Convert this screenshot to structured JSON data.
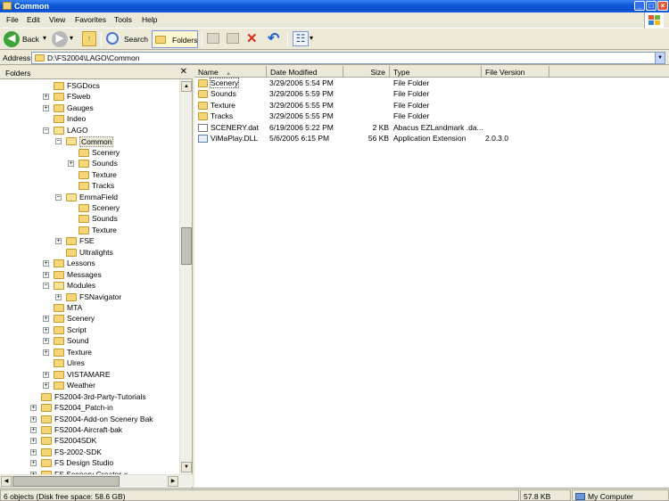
{
  "window": {
    "title": "Common",
    "min_label": "_",
    "max_label": "□",
    "close_label": "×",
    "brand_colors": {
      "titlebar": "#0b4fcf",
      "close": "#e0583a"
    }
  },
  "menu": {
    "file": "File",
    "edit": "Edit",
    "view": "View",
    "favorites": "Favorites",
    "tools": "Tools",
    "help": "Help"
  },
  "toolbar": {
    "back": "Back",
    "search": "Search",
    "folders": "Folders",
    "back_glyph": "◀",
    "forward_glyph": "▶",
    "dropdown_glyph": "▾",
    "up_glyph": "↑",
    "delete_glyph": "✕",
    "undo_glyph": "↶",
    "views_glyph": "☷"
  },
  "address": {
    "label": "Address",
    "path": "D:\\FS2004\\LAGO\\Common",
    "dropdown_glyph": "▼"
  },
  "folders_pane": {
    "header": "Folders",
    "close_glyph": "✕",
    "nodes": [
      {
        "label": "FSGDocs",
        "expander": ""
      },
      {
        "label": "FSweb",
        "expander": "+"
      },
      {
        "label": "Gauges",
        "expander": "+"
      },
      {
        "label": "Indeo",
        "expander": ""
      },
      {
        "label": "LAGO",
        "expander": "−"
      },
      {
        "label": "Common",
        "expander": "−"
      },
      {
        "label": "Scenery",
        "expander": ""
      },
      {
        "label": "Sounds",
        "expander": "+"
      },
      {
        "label": "Texture",
        "expander": ""
      },
      {
        "label": "Tracks",
        "expander": ""
      },
      {
        "label": "EmmaField",
        "expander": "−"
      },
      {
        "label": "Scenery",
        "expander": ""
      },
      {
        "label": "Sounds",
        "expander": ""
      },
      {
        "label": "Texture",
        "expander": ""
      },
      {
        "label": "FSE",
        "expander": "+"
      },
      {
        "label": "Ultralights",
        "expander": ""
      },
      {
        "label": "Lessons",
        "expander": "+"
      },
      {
        "label": "Messages",
        "expander": "+"
      },
      {
        "label": "Modules",
        "expander": "−"
      },
      {
        "label": "FSNavigator",
        "expander": "+"
      },
      {
        "label": "MTA",
        "expander": ""
      },
      {
        "label": "Scenery",
        "expander": "+"
      },
      {
        "label": "Script",
        "expander": "+"
      },
      {
        "label": "Sound",
        "expander": "+"
      },
      {
        "label": "Texture",
        "expander": "+"
      },
      {
        "label": "Uires",
        "expander": ""
      },
      {
        "label": "VISTAMARE",
        "expander": "+"
      },
      {
        "label": "Weather",
        "expander": "+"
      },
      {
        "label": "FS2004-3rd-Party-Tutorials",
        "expander": ""
      },
      {
        "label": "FS2004_Patch-in",
        "expander": "+"
      },
      {
        "label": "FS2004-Add-on Scenery Bak",
        "expander": "+"
      },
      {
        "label": "FS2004-Aircraft-bak",
        "expander": "+"
      },
      {
        "label": "FS2004SDK",
        "expander": "+"
      },
      {
        "label": "FS-2002-SDK",
        "expander": "+"
      },
      {
        "label": "FS Design Studio",
        "expander": "+"
      },
      {
        "label": "FS Scenery Creator-x",
        "expander": "+"
      }
    ],
    "scroll_up": "▲",
    "scroll_down": "▼",
    "scroll_left": "◀",
    "scroll_right": "▶"
  },
  "file_list": {
    "columns": {
      "name": "Name",
      "sort_glyph": "▲",
      "date": "Date Modified",
      "size": "Size",
      "type": "Type",
      "version": "File Version"
    },
    "rows": [
      {
        "icon": "folder-icon",
        "name": "Scenery",
        "date": "3/29/2006 5:54 PM",
        "size": "",
        "type": "File Folder",
        "version": ""
      },
      {
        "icon": "folder-icon",
        "name": "Sounds",
        "date": "3/29/2006 5:59 PM",
        "size": "",
        "type": "File Folder",
        "version": ""
      },
      {
        "icon": "folder-icon",
        "name": "Texture",
        "date": "3/29/2006 5:55 PM",
        "size": "",
        "type": "File Folder",
        "version": ""
      },
      {
        "icon": "folder-icon",
        "name": "Tracks",
        "date": "3/29/2006 5:55 PM",
        "size": "",
        "type": "File Folder",
        "version": ""
      },
      {
        "icon": "document-icon",
        "name": "SCENERY.dat",
        "date": "6/19/2006 5:22 PM",
        "size": "2 KB",
        "type": "Abacus EZLandmark .da...",
        "version": ""
      },
      {
        "icon": "dll-icon",
        "name": "ViMaPlay.DLL",
        "date": "5/6/2005 6:15 PM",
        "size": "56 KB",
        "type": "Application Extension",
        "version": "2.0.3.0"
      }
    ]
  },
  "status": {
    "objects": "6 objects (Disk free space: 58.6 GB)",
    "size": "57.8 KB",
    "location": "My Computer"
  }
}
